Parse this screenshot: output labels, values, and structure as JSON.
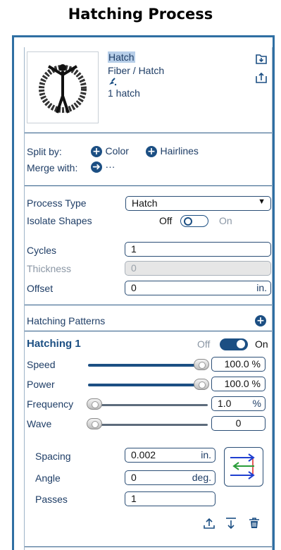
{
  "page": {
    "title": "Hatching Process"
  },
  "header": {
    "name": "Hatch",
    "type": "Fiber / Hatch",
    "count": "1 hatch",
    "icons": [
      "import-icon",
      "export-icon",
      "pen-icon"
    ]
  },
  "split": {
    "split_label": "Split by:",
    "merge_label": "Merge with:",
    "color_label": "Color",
    "hairlines_label": "Hairlines",
    "merge_more": "···"
  },
  "process": {
    "type_label": "Process Type",
    "type_value": "Hatch",
    "isolate_label": "Isolate Shapes",
    "isolate_off": "Off",
    "isolate_on": "On",
    "isolate_state": "off"
  },
  "params": {
    "cycles_label": "Cycles",
    "cycles_value": "1",
    "thickness_label": "Thickness",
    "thickness_value": "0",
    "offset_label": "Offset",
    "offset_value": "0",
    "offset_unit": "in."
  },
  "patterns": {
    "section_label": "Hatching Patterns",
    "item_title": "Hatching 1",
    "item_off": "Off",
    "item_on": "On",
    "item_state": "on",
    "speed_label": "Speed",
    "speed_value": "100.0 %",
    "speed_level": 1.0,
    "power_label": "Power",
    "power_value": "100.0 %",
    "power_level": 1.0,
    "frequency_label": "Frequency",
    "frequency_value": "1.0",
    "frequency_unit": "%",
    "frequency_level": 0.0,
    "wave_label": "Wave",
    "wave_value": "0",
    "wave_level": 0.0,
    "spacing_label": "Spacing",
    "spacing_value": "0.002",
    "spacing_unit": "in.",
    "angle_label": "Angle",
    "angle_value": "0",
    "angle_unit": "deg.",
    "passes_label": "Passes",
    "passes_value": "1"
  },
  "colors": {
    "accent": "#1c4f83",
    "border": "#2f6fa3",
    "arrow_green": "#2a9d3a",
    "arrow_blue": "#1f3fd0",
    "arrow_red": "#d33"
  }
}
